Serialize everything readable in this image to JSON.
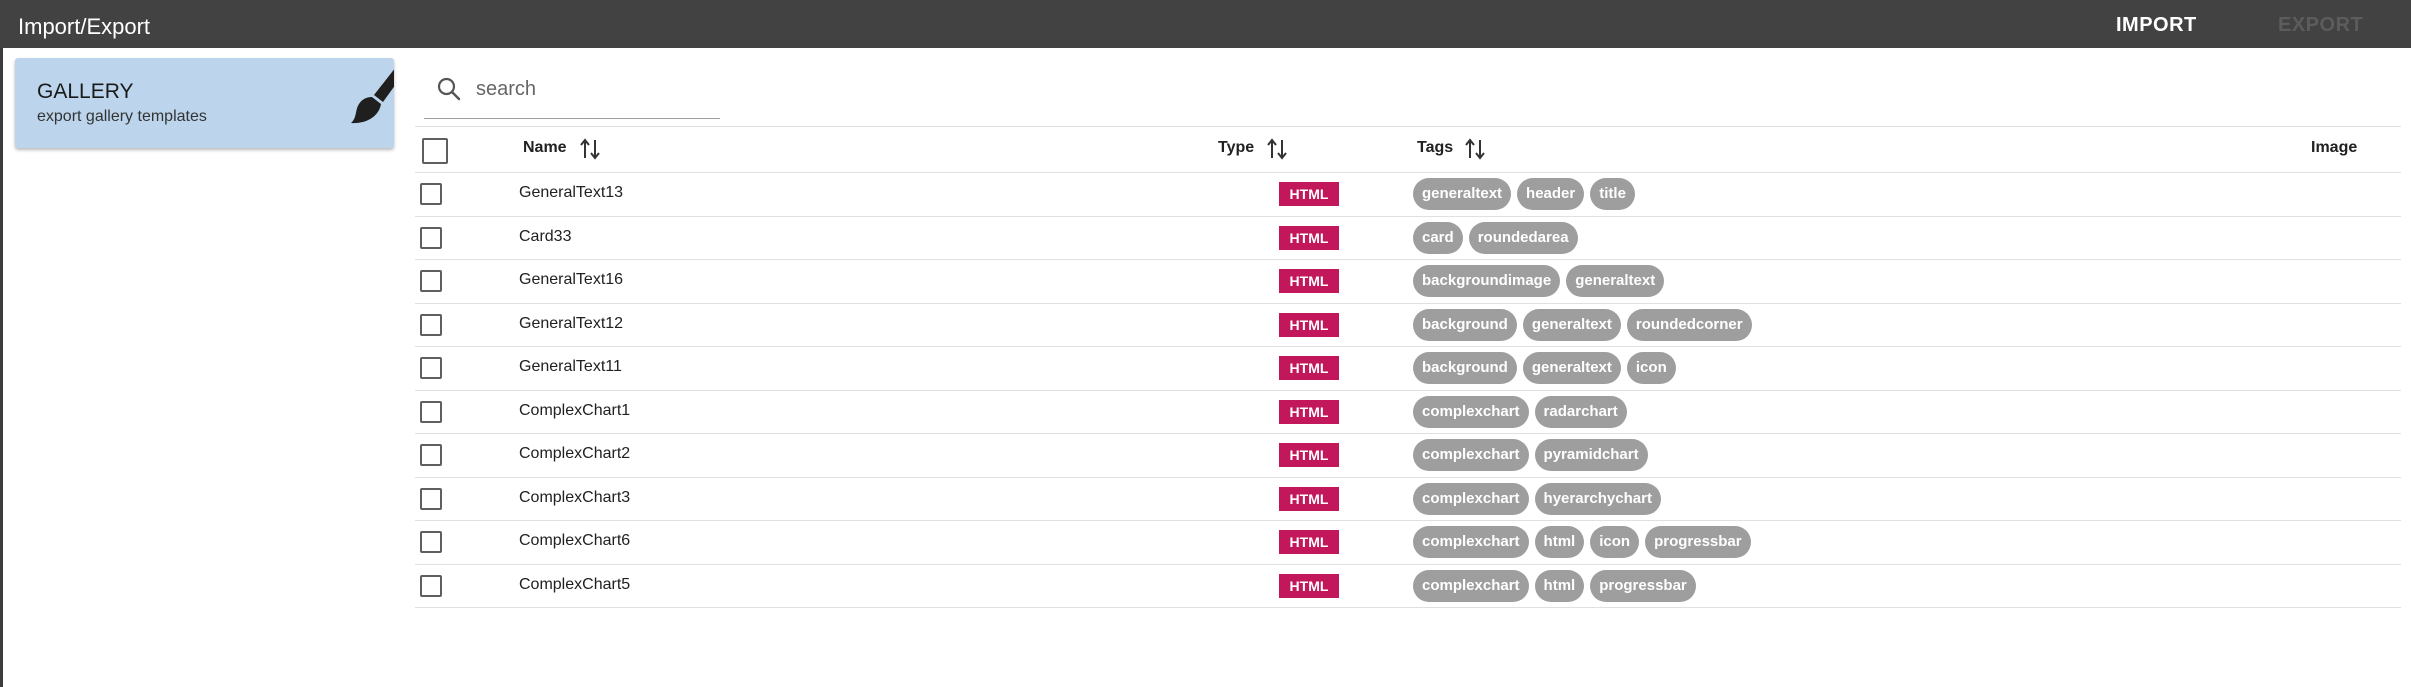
{
  "header": {
    "title": "Import/Export",
    "import_label": "IMPORT",
    "export_label": "EXPORT"
  },
  "gallery_card": {
    "title": "GALLERY",
    "subtitle": "export gallery templates",
    "icon": "paintbrush-icon"
  },
  "search": {
    "placeholder": "search",
    "value": ""
  },
  "table": {
    "columns": {
      "name": "Name",
      "type": "Type",
      "tags": "Tags",
      "image": "Image"
    },
    "rows": [
      {
        "name": "GeneralText13",
        "type": "HTML",
        "tags": [
          "generaltext",
          "header",
          "title"
        ]
      },
      {
        "name": "Card33",
        "type": "HTML",
        "tags": [
          "card",
          "roundedarea"
        ]
      },
      {
        "name": "GeneralText16",
        "type": "HTML",
        "tags": [
          "backgroundimage",
          "generaltext"
        ]
      },
      {
        "name": "GeneralText12",
        "type": "HTML",
        "tags": [
          "background",
          "generaltext",
          "roundedcorner"
        ]
      },
      {
        "name": "GeneralText11",
        "type": "HTML",
        "tags": [
          "background",
          "generaltext",
          "icon"
        ]
      },
      {
        "name": "ComplexChart1",
        "type": "HTML",
        "tags": [
          "complexchart",
          "radarchart"
        ]
      },
      {
        "name": "ComplexChart2",
        "type": "HTML",
        "tags": [
          "complexchart",
          "pyramidchart"
        ]
      },
      {
        "name": "ComplexChart3",
        "type": "HTML",
        "tags": [
          "complexchart",
          "hyerarchychart"
        ]
      },
      {
        "name": "ComplexChart6",
        "type": "HTML",
        "tags": [
          "complexchart",
          "html",
          "icon",
          "progressbar"
        ]
      },
      {
        "name": "ComplexChart5",
        "type": "HTML",
        "tags": [
          "complexchart",
          "html",
          "progressbar"
        ]
      }
    ]
  },
  "colors": {
    "topbar": "#424242",
    "card": "#bcd5ec",
    "type_badge": "#c2185b",
    "tag": "#9e9e9e"
  }
}
